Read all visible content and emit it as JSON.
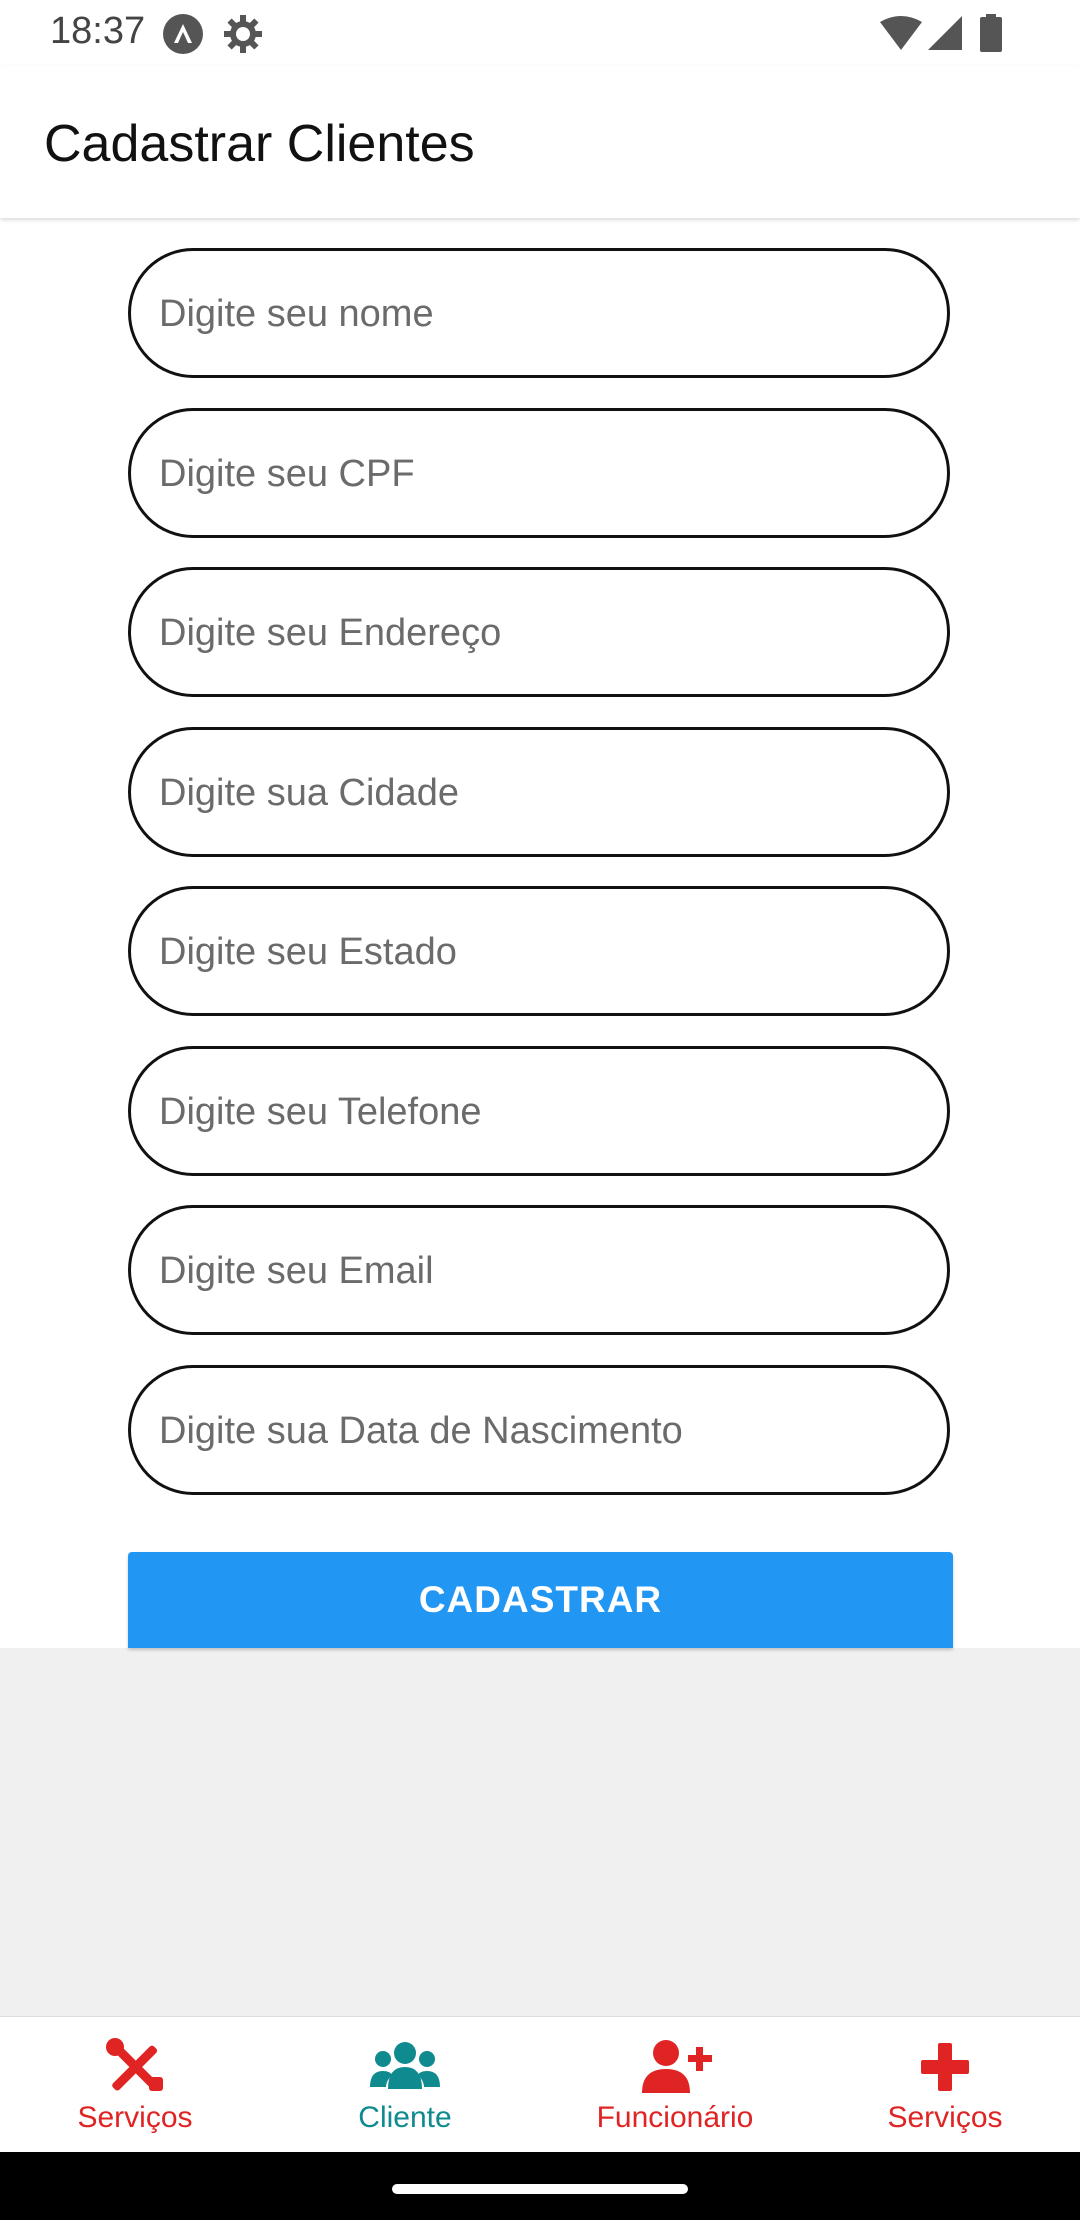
{
  "status_bar": {
    "time": "18:37",
    "icons": [
      "app-notification-icon",
      "settings-icon",
      "wifi-icon",
      "signal-icon",
      "battery-icon"
    ]
  },
  "app_bar": {
    "title": "Cadastrar Clientes"
  },
  "form": {
    "fields": [
      {
        "placeholder": "Digite seu nome",
        "value": ""
      },
      {
        "placeholder": "Digite seu CPF",
        "value": ""
      },
      {
        "placeholder": "Digite seu Endereço",
        "value": ""
      },
      {
        "placeholder": "Digite sua Cidade",
        "value": ""
      },
      {
        "placeholder": "Digite seu Estado",
        "value": ""
      },
      {
        "placeholder": "Digite seu Telefone",
        "value": ""
      },
      {
        "placeholder": "Digite seu Email",
        "value": ""
      },
      {
        "placeholder": "Digite sua Data de Nascimento",
        "value": ""
      }
    ],
    "submit_label": "CADASTRAR"
  },
  "bottom_nav": {
    "items": [
      {
        "label": "Serviços",
        "icon": "tools-icon",
        "active": false
      },
      {
        "label": "Cliente",
        "icon": "users-icon",
        "active": true
      },
      {
        "label": "Funcionário",
        "icon": "user-plus-icon",
        "active": false
      },
      {
        "label": "Serviços",
        "icon": "plus-icon",
        "active": false
      }
    ]
  },
  "colors": {
    "accent": "#2196f3",
    "nav_active": "#0f8a8f",
    "nav_inactive": "#e02424",
    "field_border": "#111111"
  }
}
